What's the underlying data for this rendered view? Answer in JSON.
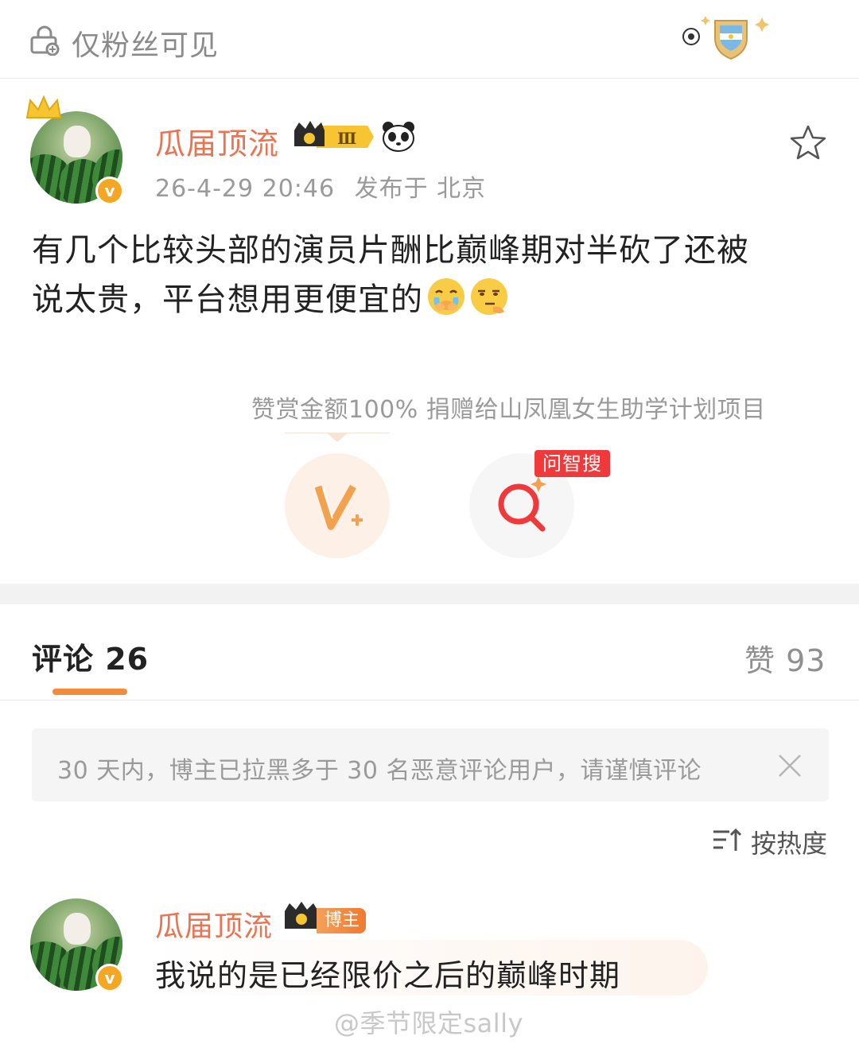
{
  "header": {
    "visibility_label": "仅粉丝可见",
    "visibility_icon": "lock-icon",
    "fan_badge_icon": "argentina-shield-badge-icon"
  },
  "post": {
    "author": "瓜届顶流",
    "level_badge_text": "Ⅲ",
    "timestamp": "26-4-29 20:46",
    "location": "发布于 北京",
    "text_line1": "有几个比较头部的演员片酬比巅峰期对半砍了还被",
    "text_line2": "说太贵，平台想用更便宜的",
    "emojis": [
      "crying-face-emoji",
      "thinking-face-emoji"
    ]
  },
  "reward": {
    "note": "赞赏金额100% 捐赠给山凤凰女生助学计划项目",
    "reward_icon": "v-plus-icon",
    "search_tag": "问智搜",
    "search_icon": "smart-search-icon"
  },
  "comments_section": {
    "title": "评论 26",
    "likes_label": "赞 93",
    "notice": "30 天内，博主已拉黑多于 30 名恶意评论用户，请谨慎评论",
    "sort_label": "按热度"
  },
  "comment": {
    "author": "瓜届顶流",
    "author_tag": "博主",
    "text": "我说的是已经限价之后的巅峰时期"
  },
  "watermark": "@季节限定sally",
  "colors": {
    "username": "#eb7350",
    "accent_orange": "#f28b3a",
    "tag_red": "#f0393a",
    "muted_text": "#9a9a9a"
  }
}
